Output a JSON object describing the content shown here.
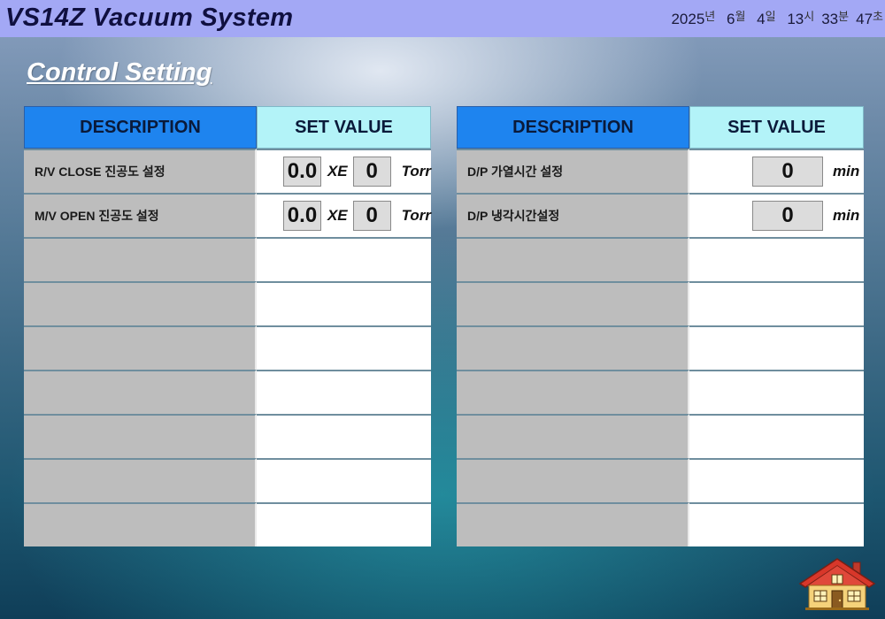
{
  "header": {
    "title": "VS14Z Vacuum System",
    "clock": {
      "year": "2025",
      "year_unit": "년",
      "month": "6",
      "month_unit": "월",
      "day": "4",
      "day_unit": "일",
      "hour": "13",
      "hour_unit": "시",
      "minute": "33",
      "minute_unit": "분",
      "second": "47",
      "second_unit": "초"
    }
  },
  "page_title": "Control Setting",
  "left_table": {
    "col_description": "DESCRIPTION",
    "col_set_value": "SET VALUE",
    "rows": [
      {
        "label": "R/V CLOSE 진공도 설정",
        "mantissa": "0.0",
        "exp_label": "XE",
        "exponent": "0",
        "unit": "Torr"
      },
      {
        "label": "M/V OPEN 진공도 설정",
        "mantissa": "0.0",
        "exp_label": "XE",
        "exponent": "0",
        "unit": "Torr"
      }
    ]
  },
  "right_table": {
    "col_description": "DESCRIPTION",
    "col_set_value": "SET VALUE",
    "rows": [
      {
        "label": "D/P 가열시간 설정",
        "value": "0",
        "unit": "min"
      },
      {
        "label": "D/P 냉각시간설정",
        "value": "0",
        "unit": "min"
      }
    ]
  },
  "colors": {
    "header_bg": "#a3a8f5",
    "desc_header_bg": "#1e84ef",
    "value_header_bg": "#b3f3f8",
    "desc_cell_bg": "#bdbdbd",
    "value_cell_bg": "#ffffff"
  },
  "icons": {
    "home": "house-icon"
  }
}
